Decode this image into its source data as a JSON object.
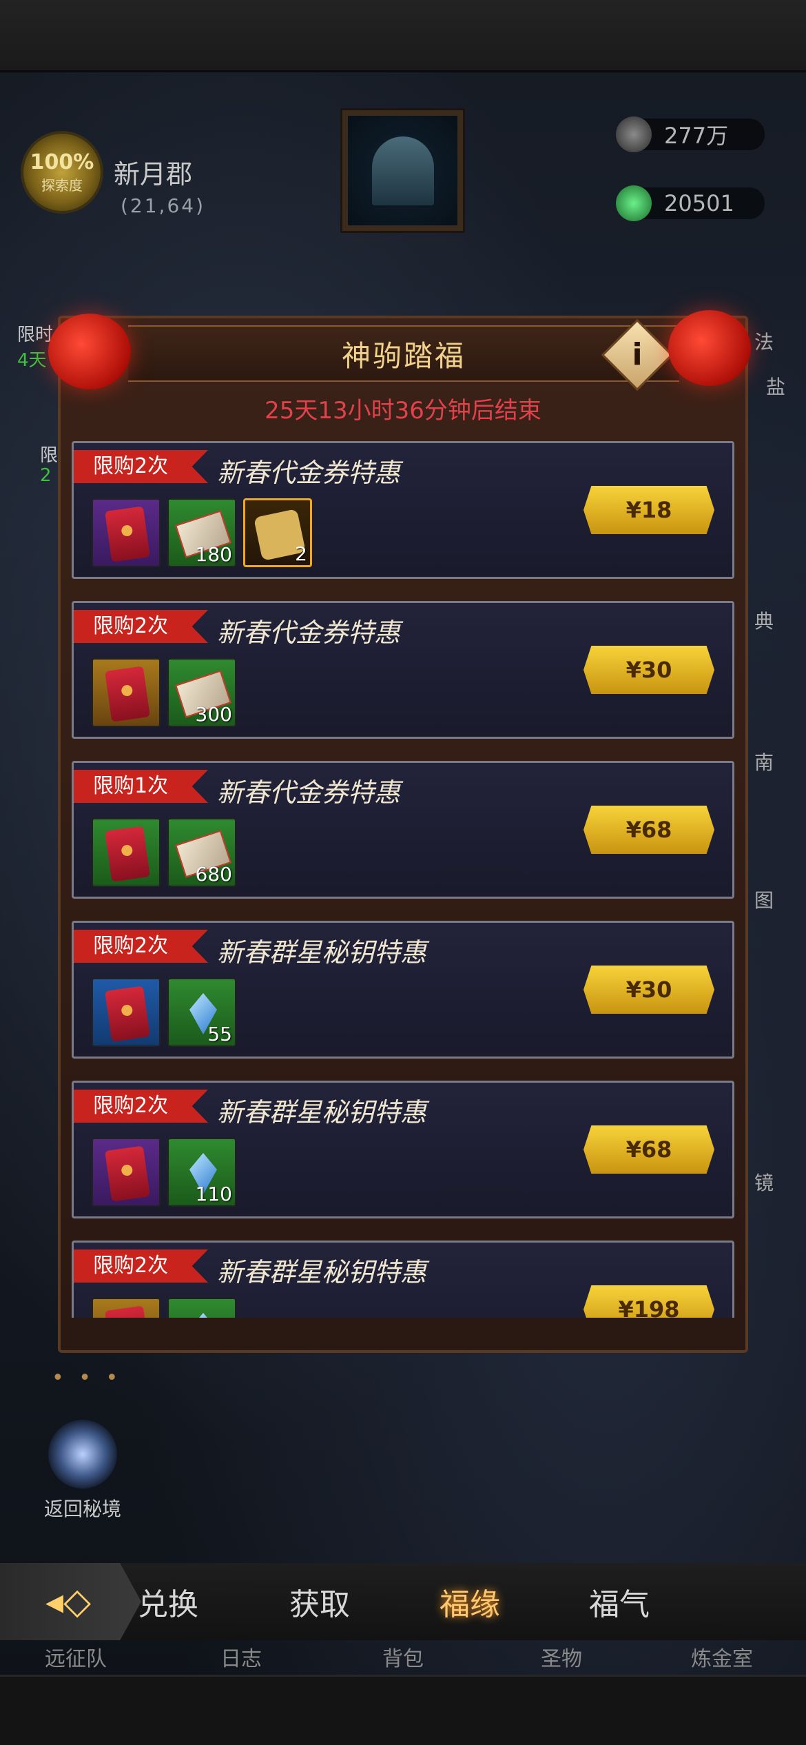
{
  "location": {
    "explore_pct": "100%",
    "explore_label": "探索度",
    "name": "新月郡",
    "coords": "(21,64)"
  },
  "resources": [
    {
      "value": "277万",
      "icon": "ore-icon"
    },
    {
      "value": "20501",
      "icon": "emerald-icon"
    }
  ],
  "side_left": [
    {
      "text": "限时",
      "color": "#c9c9c9"
    },
    {
      "text": "4天",
      "color": "#3ec23e"
    },
    {
      "text": "限",
      "color": "#c9c9c9"
    },
    {
      "text": "2",
      "color": "#3ec23e"
    }
  ],
  "side_right": [
    "法",
    "盐",
    "典",
    "南",
    "图",
    "镜"
  ],
  "panel": {
    "title": "神驹踏福",
    "countdown": "25天13小时36分钟后结束",
    "info_icon": "i"
  },
  "offers": [
    {
      "limit": "限购2次",
      "title": "新春代金券特惠",
      "price": "¥18",
      "items": [
        {
          "type": "envelope",
          "bg": "purple",
          "qty": ""
        },
        {
          "type": "ticket",
          "bg": "green",
          "qty": "180"
        },
        {
          "type": "puzzle",
          "bg": "orange",
          "qty": "2"
        }
      ]
    },
    {
      "limit": "限购2次",
      "title": "新春代金券特惠",
      "price": "¥30",
      "items": [
        {
          "type": "envelope",
          "bg": "gold",
          "qty": ""
        },
        {
          "type": "ticket",
          "bg": "green",
          "qty": "300"
        }
      ]
    },
    {
      "limit": "限购1次",
      "title": "新春代金券特惠",
      "price": "¥68",
      "items": [
        {
          "type": "envelope",
          "bg": "green",
          "qty": ""
        },
        {
          "type": "ticket",
          "bg": "green",
          "qty": "680"
        }
      ]
    },
    {
      "limit": "限购2次",
      "title": "新春群星秘钥特惠",
      "price": "¥30",
      "items": [
        {
          "type": "envelope",
          "bg": "blue",
          "qty": ""
        },
        {
          "type": "crystal",
          "bg": "green",
          "qty": "55"
        }
      ]
    },
    {
      "limit": "限购2次",
      "title": "新春群星秘钥特惠",
      "price": "¥68",
      "items": [
        {
          "type": "envelope",
          "bg": "purple",
          "qty": ""
        },
        {
          "type": "crystal",
          "bg": "green",
          "qty": "110"
        }
      ]
    },
    {
      "limit": "限购2次",
      "title": "新春群星秘钥特惠",
      "price": "¥198",
      "items": [
        {
          "type": "envelope",
          "bg": "gold",
          "qty": ""
        },
        {
          "type": "crystal",
          "bg": "green",
          "qty": ""
        }
      ]
    }
  ],
  "return_label": "返回秘境",
  "dots": "• • •",
  "tabs": [
    {
      "label": "兑换",
      "active": false
    },
    {
      "label": "获取",
      "active": false
    },
    {
      "label": "福缘",
      "active": true
    },
    {
      "label": "福气",
      "active": false
    }
  ],
  "bottom_nav": [
    "远征队",
    "日志",
    "背包",
    "圣物",
    "炼金室"
  ],
  "back_icon": "back-arrow-icon"
}
